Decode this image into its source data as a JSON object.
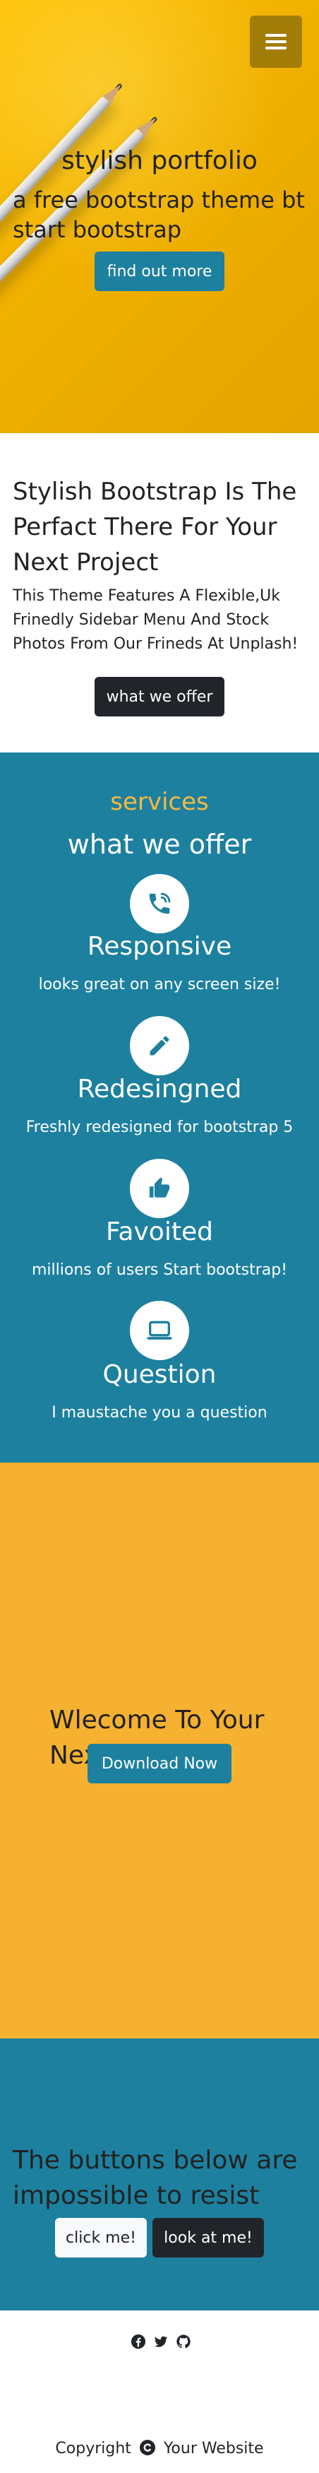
{
  "hero": {
    "title": "stylish portfolio",
    "subtitle": "a free bootstrap theme bt start bootstrap",
    "button_label": "find out more",
    "menu_icon": "hamburger-menu-icon"
  },
  "about": {
    "title": "Stylish Bootstrap Is The Perfact There For Your Next Project",
    "text": "This Theme Features A Flexible,Uk Frinedly Sidebar Menu And Stock Photos From Our Frineds At Unplash!",
    "button_label": "what we offer"
  },
  "services": {
    "kicker": "services",
    "heading": "what we offer",
    "items": [
      {
        "icon": "phone-icon",
        "title": "Responsive",
        "text": "looks great on any screen size!"
      },
      {
        "icon": "pencil-icon",
        "title": "Redesingned",
        "text": "Freshly redesigned for bootstrap 5"
      },
      {
        "icon": "thumbs-up-icon",
        "title": "Favoited",
        "text": "millions of users Start bootstrap!"
      },
      {
        "icon": "laptop-icon",
        "title": "Question",
        "text": "I maustache you a question"
      }
    ]
  },
  "callout": {
    "title": "Wlecome To Your Next Website",
    "button_label": "Download Now"
  },
  "cta": {
    "title": "The buttons below are impossible to resist",
    "button_primary": "click me!",
    "button_secondary": "look at me!"
  },
  "footer": {
    "social_icons": [
      "facebook-icon",
      "twitter-icon",
      "github-icon"
    ],
    "copyright_prefix": "Copyright",
    "copyright_suffix": "Your Website"
  },
  "colors": {
    "primary": "#1d809f",
    "accent": "#f4b942",
    "callout_bg": "#f5b12f",
    "dark": "#212529",
    "hero_bg": "#f0b400"
  }
}
